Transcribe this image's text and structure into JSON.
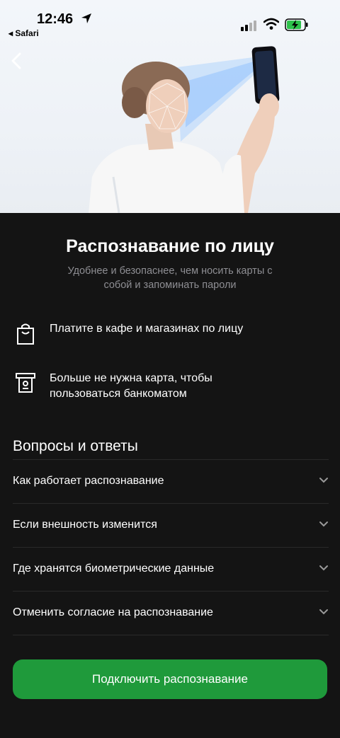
{
  "status_bar": {
    "time": "12:46",
    "back_app": "◂ Safari"
  },
  "hero": {
    "description_icon": "face-scan-illustration"
  },
  "screen": {
    "title": "Распознавание по лицу",
    "subtitle": "Удобнее и безопаснее, чем носить карты с собой и запоминать пароли"
  },
  "features": [
    {
      "icon": "shopping-bag-icon",
      "text": "Платите в кафе и магазинах по лицу"
    },
    {
      "icon": "atm-icon",
      "text": "Больше не нужна карта, чтобы пользоваться банкоматом"
    }
  ],
  "faq": {
    "title": "Вопросы и ответы",
    "items": [
      {
        "question": "Как работает распознавание"
      },
      {
        "question": "Если внешность изменится"
      },
      {
        "question": "Где хранятся биометрические данные"
      },
      {
        "question": "Отменить согласие на распознавание"
      }
    ]
  },
  "cta": {
    "label": "Подключить распознавание"
  },
  "colors": {
    "accent": "#1f9a3b",
    "background": "#141414",
    "muted_text": "#8e8e93"
  }
}
